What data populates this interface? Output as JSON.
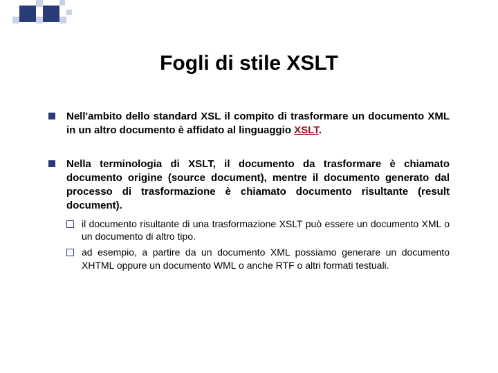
{
  "title": "Fogli di stile XSLT",
  "bullets": [
    {
      "pre": "Nell'ambito dello standard XSL il compito di trasformare un documento XML in un altro documento è affidato al linguaggio ",
      "emph": "XSLT",
      "post": "."
    },
    {
      "text": "Nella terminologia di XSLT, il documento da trasformare è chiamato documento origine (source document), mentre il documento generato dal processo di trasformazione è chiamato documento risultante (result document).",
      "sub": [
        "il documento risultante di una trasformazione XSLT può essere un documento XML o un documento di altro tipo.",
        "ad esempio, a partire da un documento XML possiamo generare un documento XHTML oppure un documento WML o anche RTF o altri formati testuali."
      ]
    }
  ]
}
